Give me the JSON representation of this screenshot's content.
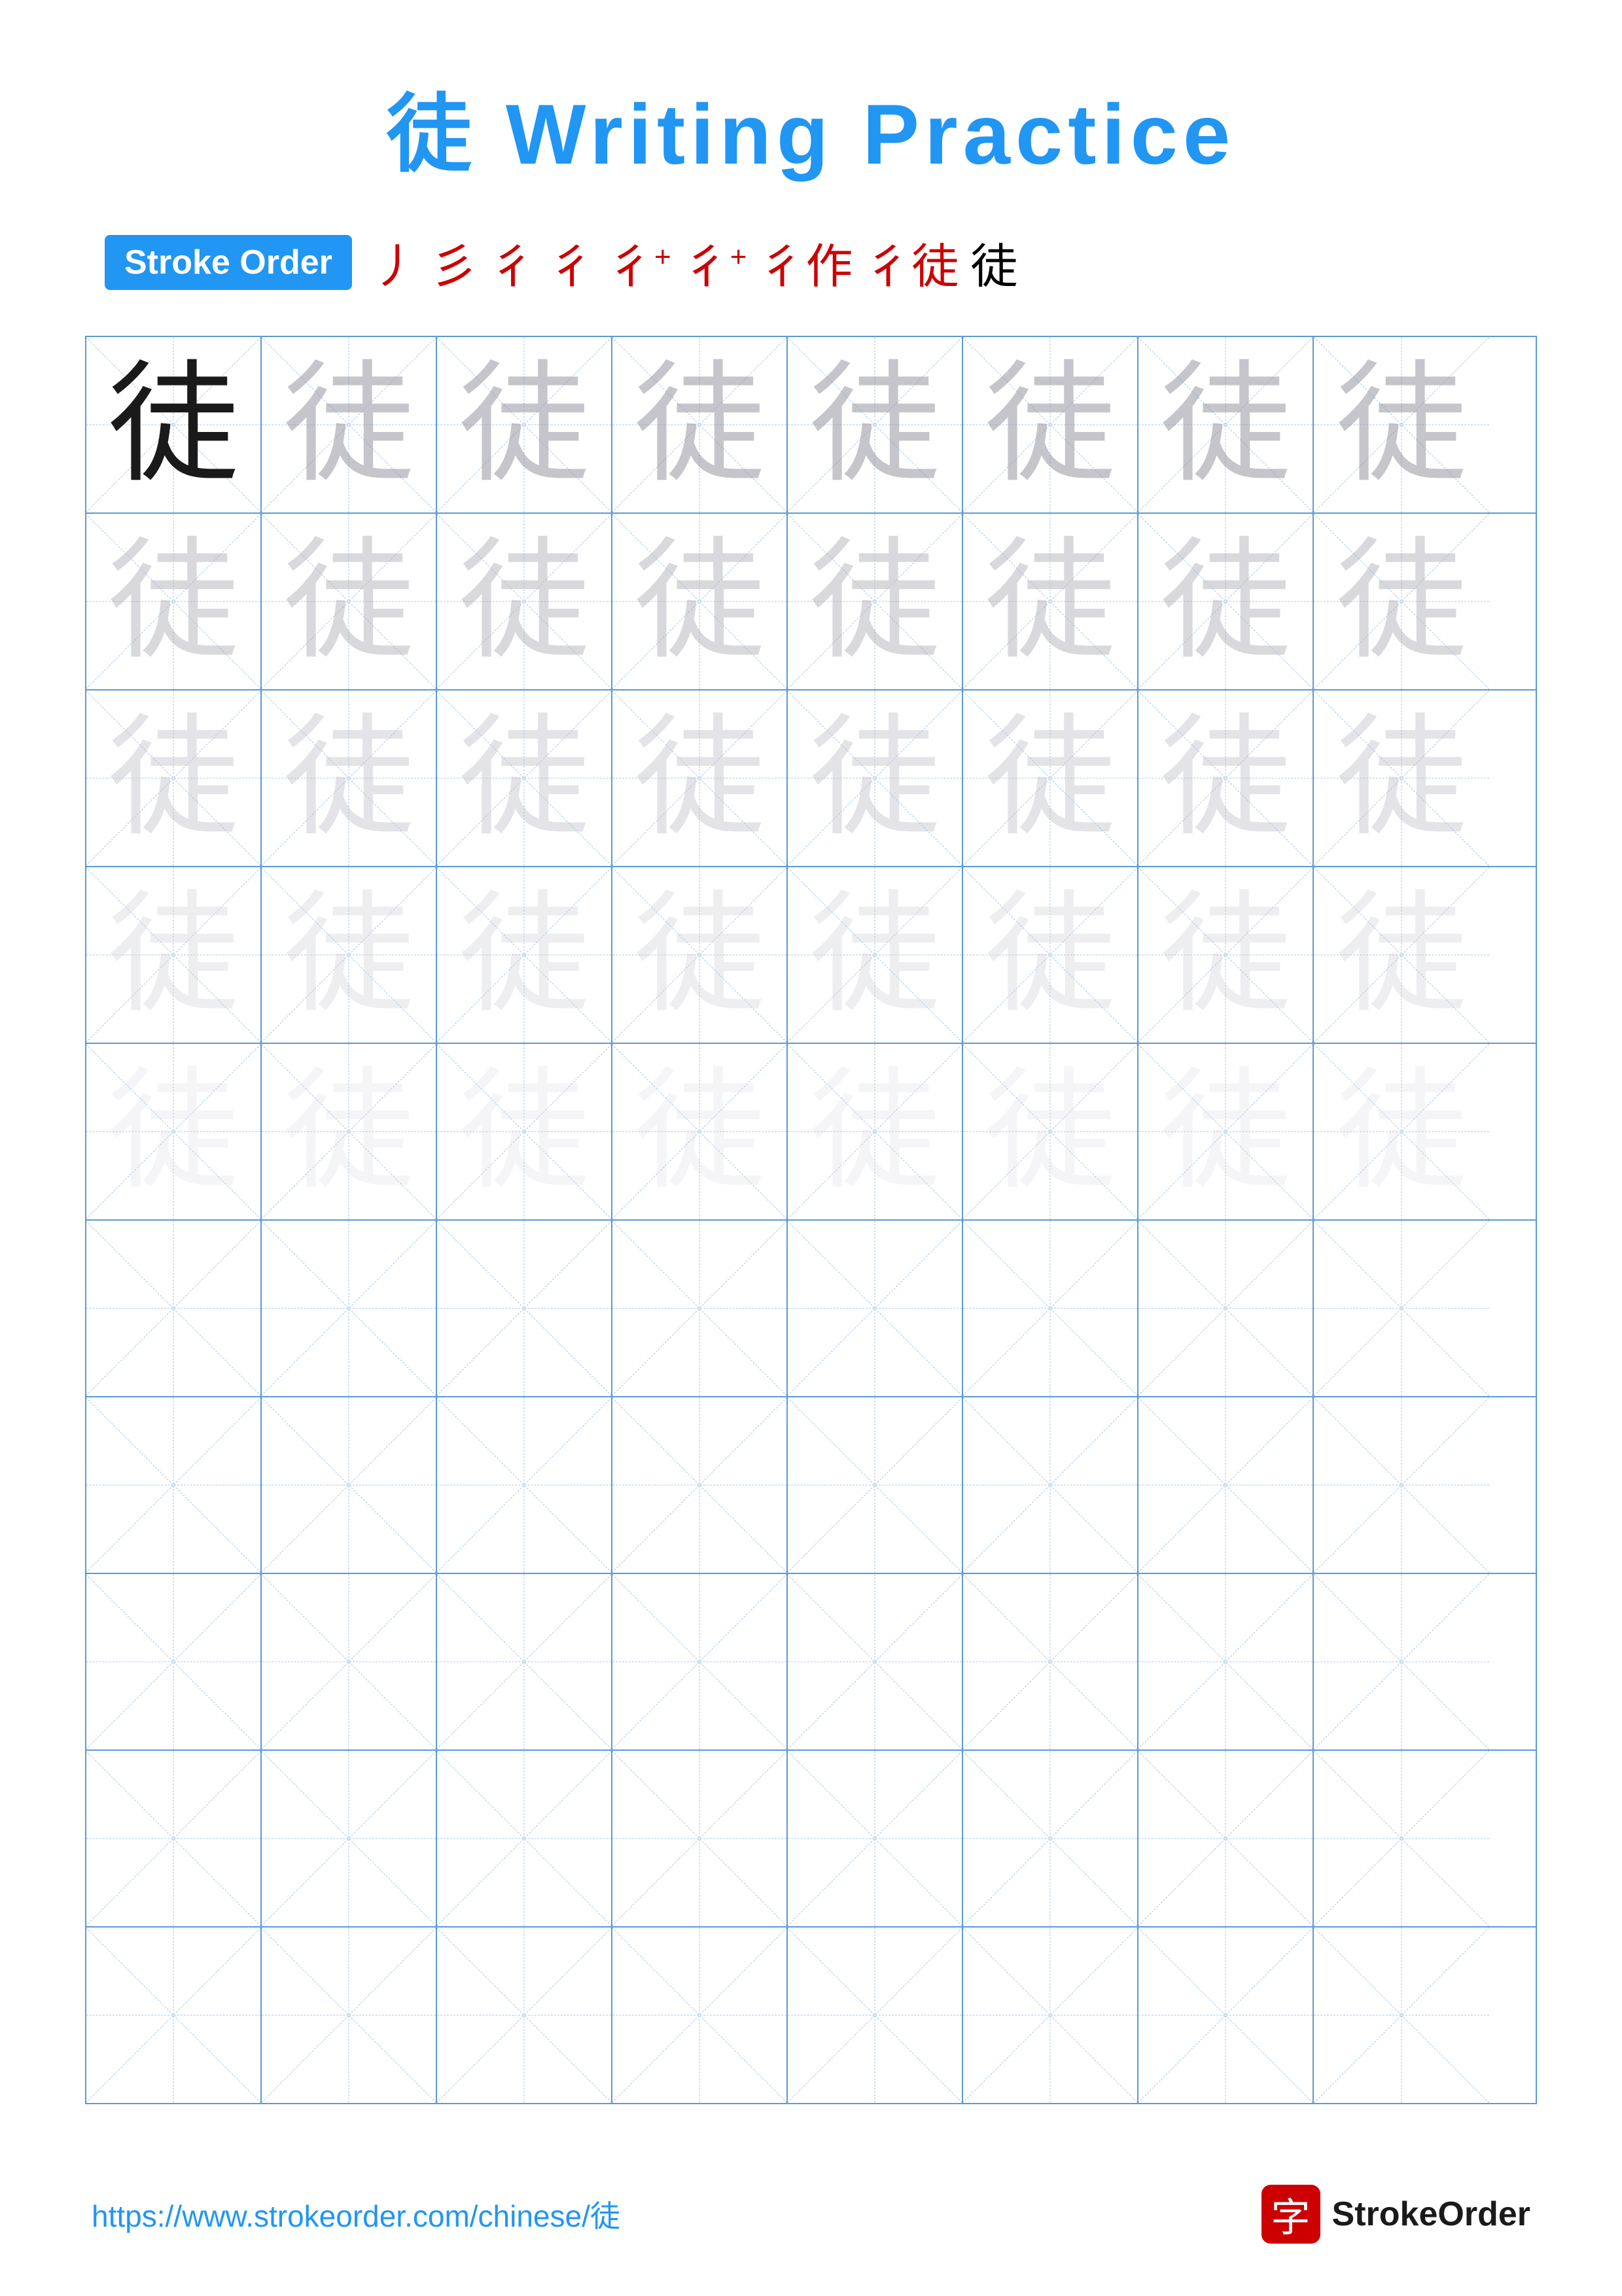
{
  "page": {
    "title": "徒 Writing Practice",
    "character": "徒",
    "stroke_order_label": "Stroke Order",
    "stroke_steps": [
      "丿",
      "彡",
      "彳",
      "彳",
      "彳+",
      "彳+",
      "彳作",
      "彳徒",
      "徒"
    ],
    "footer_url": "https://www.strokeorder.com/chinese/徒",
    "footer_logo_char": "字",
    "footer_brand": "StrokeOrder",
    "rows": 10,
    "cols": 8,
    "practice_char": "徒"
  }
}
